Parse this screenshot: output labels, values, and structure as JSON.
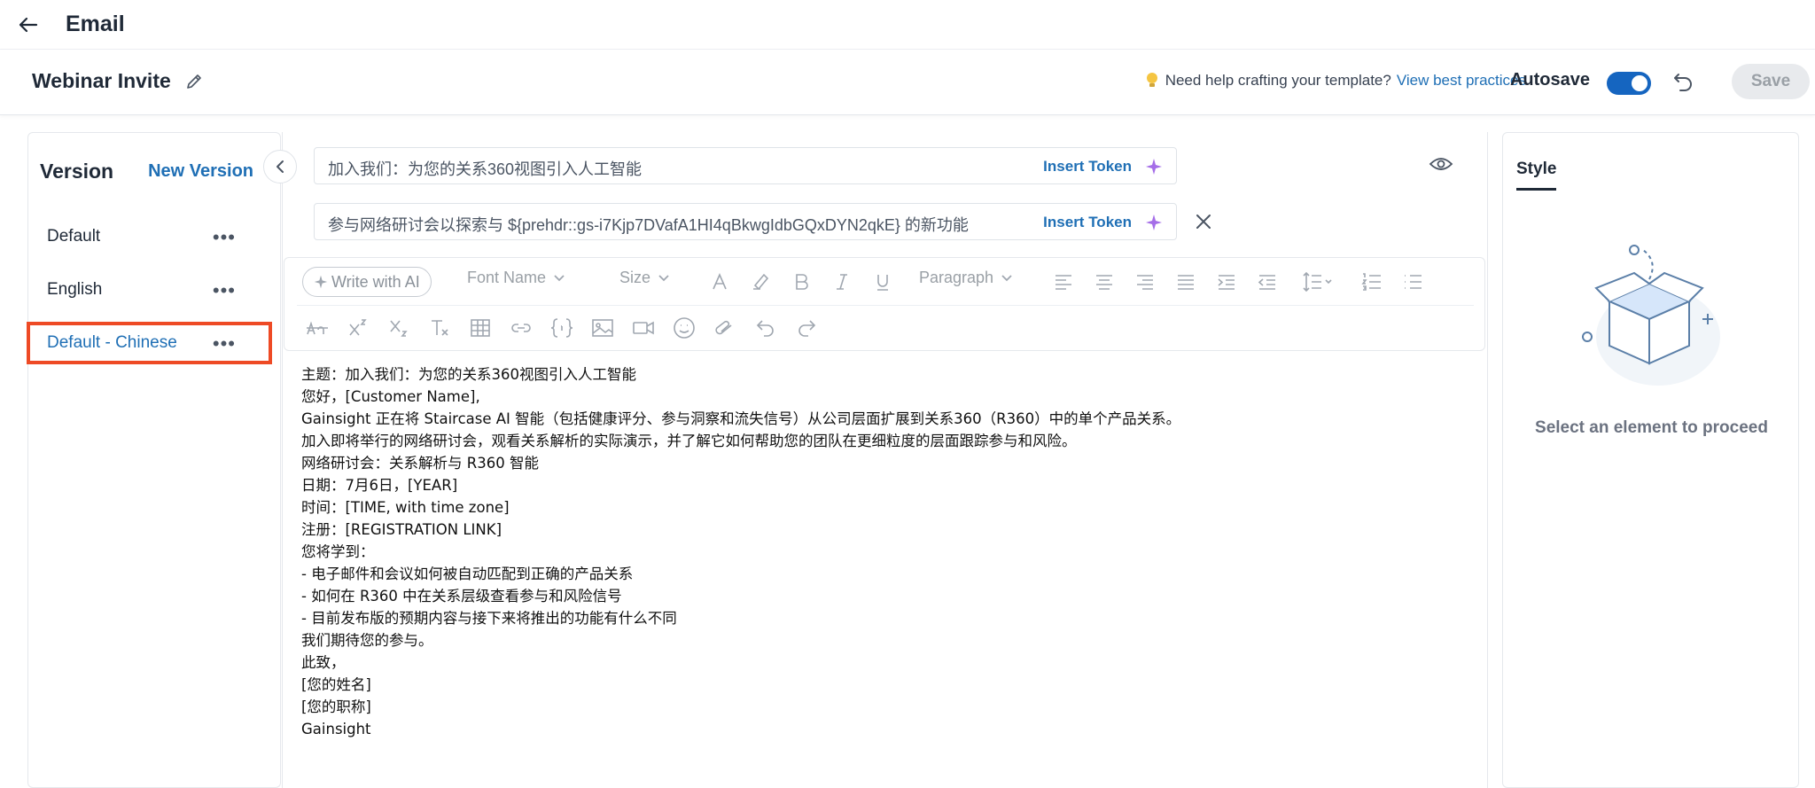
{
  "topbar": {
    "title": "Email"
  },
  "header": {
    "template_name": "Webinar Invite",
    "help_text": "Need help crafting your template?",
    "help_link": "View best practices",
    "autosave_label": "Autosave",
    "autosave_on": true,
    "save_label": "Save"
  },
  "versions": {
    "title": "Version",
    "new_version": "New Version",
    "items": [
      {
        "label": "Default",
        "active": false
      },
      {
        "label": "English",
        "active": false
      },
      {
        "label": "Default - Chinese",
        "active": true
      }
    ],
    "more_glyph": "•••"
  },
  "subject": {
    "line1": "加入我们：为您的关系360视图引入人工智能",
    "line2": "参与网络研讨会以探索与 ${prehdr::gs-i7Kjp7DVafA1HI4qBkwgIdbGQxDYN2qkE} 的新功能",
    "insert_token": "Insert Token"
  },
  "toolbar": {
    "ai_label": "Write with AI",
    "font_name": "Font Name",
    "size": "Size",
    "paragraph": "Paragraph"
  },
  "body": {
    "lines": [
      "主题：加入我们：为您的关系360视图引入人工智能",
      "您好，[Customer Name],",
      "Gainsight 正在将 Staircase AI 智能（包括健康评分、参与洞察和流失信号）从公司层面扩展到关系360（R360）中的单个产品关系。",
      "加入即将举行的网络研讨会，观看关系解析的实际演示，并了解它如何帮助您的团队在更细粒度的层面跟踪参与和风险。",
      "网络研讨会：关系解析与 R360 智能",
      "日期：7月6日，[YEAR]",
      "时间：[TIME, with time zone]",
      "注册：[REGISTRATION LINK]",
      "您将学到：",
      "- 电子邮件和会议如何被自动匹配到正确的产品关系",
      "- 如何在 R360 中在关系层级查看参与和风险信号",
      "- 目前发布版的预期内容与接下来将推出的功能有什么不同",
      "我们期待您的参与。",
      "此致，",
      "[您的姓名]",
      "[您的职称]",
      "Gainsight"
    ]
  },
  "style_panel": {
    "tab": "Style",
    "message": "Select an element to proceed"
  },
  "colors": {
    "accent": "#1f6fb5",
    "toggle": "#1565c0",
    "highlight": "#ee4a25"
  }
}
